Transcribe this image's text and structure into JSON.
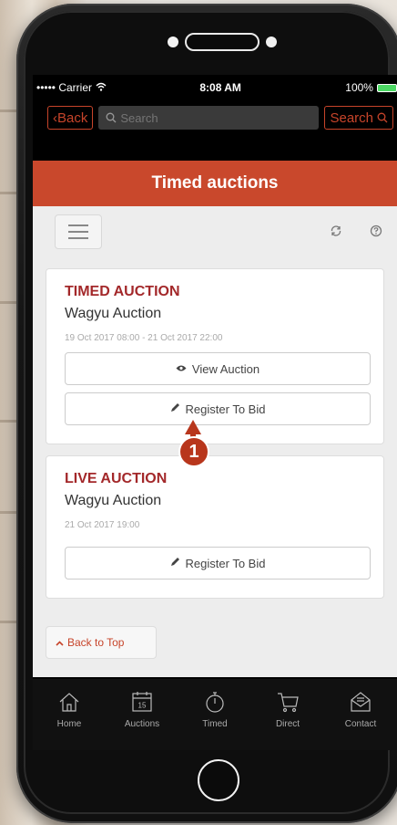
{
  "status_bar": {
    "carrier": "••••• Carrier",
    "time": "8:08 AM",
    "battery": "100%"
  },
  "nav": {
    "back_label": "Back",
    "search_placeholder": "Search",
    "search_button_label": "Search"
  },
  "page": {
    "title": "Timed auctions"
  },
  "cards": [
    {
      "type": "TIMED AUCTION",
      "title": "Wagyu Auction",
      "date": "19 Oct 2017 08:00 - 21 Oct 2017 22:00",
      "view_label": "View Auction",
      "register_label": "Register To Bid"
    },
    {
      "type": "LIVE AUCTION",
      "title": "Wagyu Auction",
      "date": "21 Oct 2017 19:00",
      "register_label": "Register To Bid"
    }
  ],
  "back_to_top_label": "Back to Top",
  "callout_number": "1",
  "tabs": [
    {
      "label": "Home",
      "icon": "home-icon"
    },
    {
      "label": "Auctions",
      "icon": "calendar-icon",
      "badge": "15"
    },
    {
      "label": "Timed",
      "icon": "stopwatch-icon"
    },
    {
      "label": "Direct",
      "icon": "cart-icon"
    },
    {
      "label": "Contact",
      "icon": "mail-icon"
    }
  ],
  "colors": {
    "accent": "#c9482c",
    "auction_type": "#a3282a"
  }
}
